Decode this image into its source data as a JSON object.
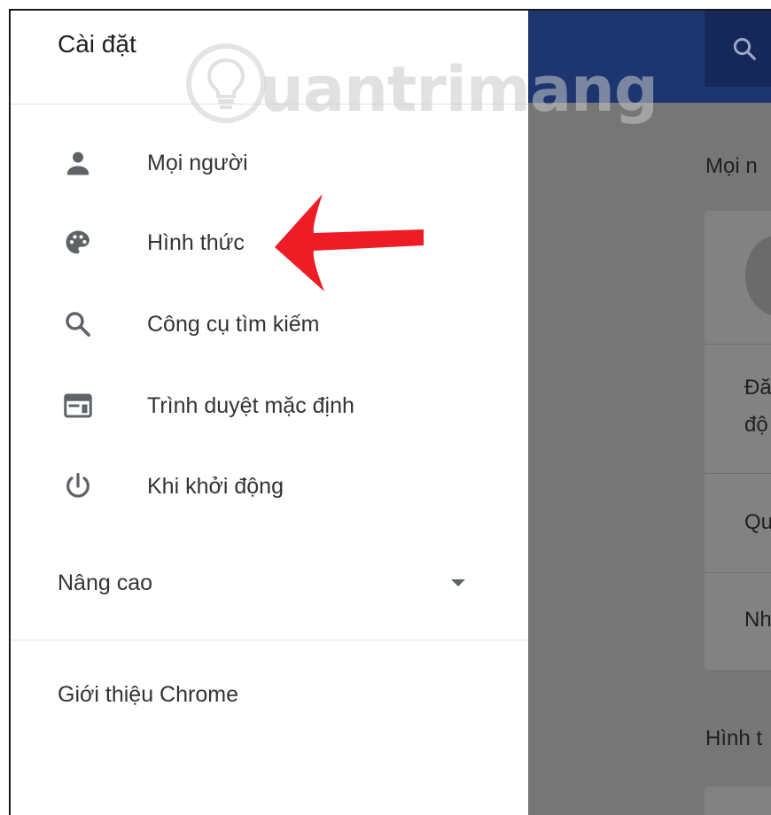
{
  "drawer": {
    "title": "Cài đặt",
    "items": [
      {
        "label": "Mọi người",
        "icon": "person-icon"
      },
      {
        "label": "Hình thức",
        "icon": "palette-icon"
      },
      {
        "label": "Công cụ tìm kiếm",
        "icon": "search-icon"
      },
      {
        "label": "Trình duyệt mặc định",
        "icon": "browser-window-icon"
      },
      {
        "label": "Khi khởi động",
        "icon": "power-icon"
      }
    ],
    "advanced_label": "Nâng cao",
    "about_label": "Giới thiệu Chrome"
  },
  "background": {
    "section1": "Mọi n",
    "row1a": "Đă",
    "row1b": "độ",
    "row2": "Qu",
    "row3": "Nh",
    "section2": "Hình t"
  },
  "watermark": {
    "text": "uantrimang"
  },
  "colors": {
    "header": "#1d3670",
    "overlay": "#767676",
    "icon": "#5f6368",
    "arrow": "#ee1c24"
  }
}
